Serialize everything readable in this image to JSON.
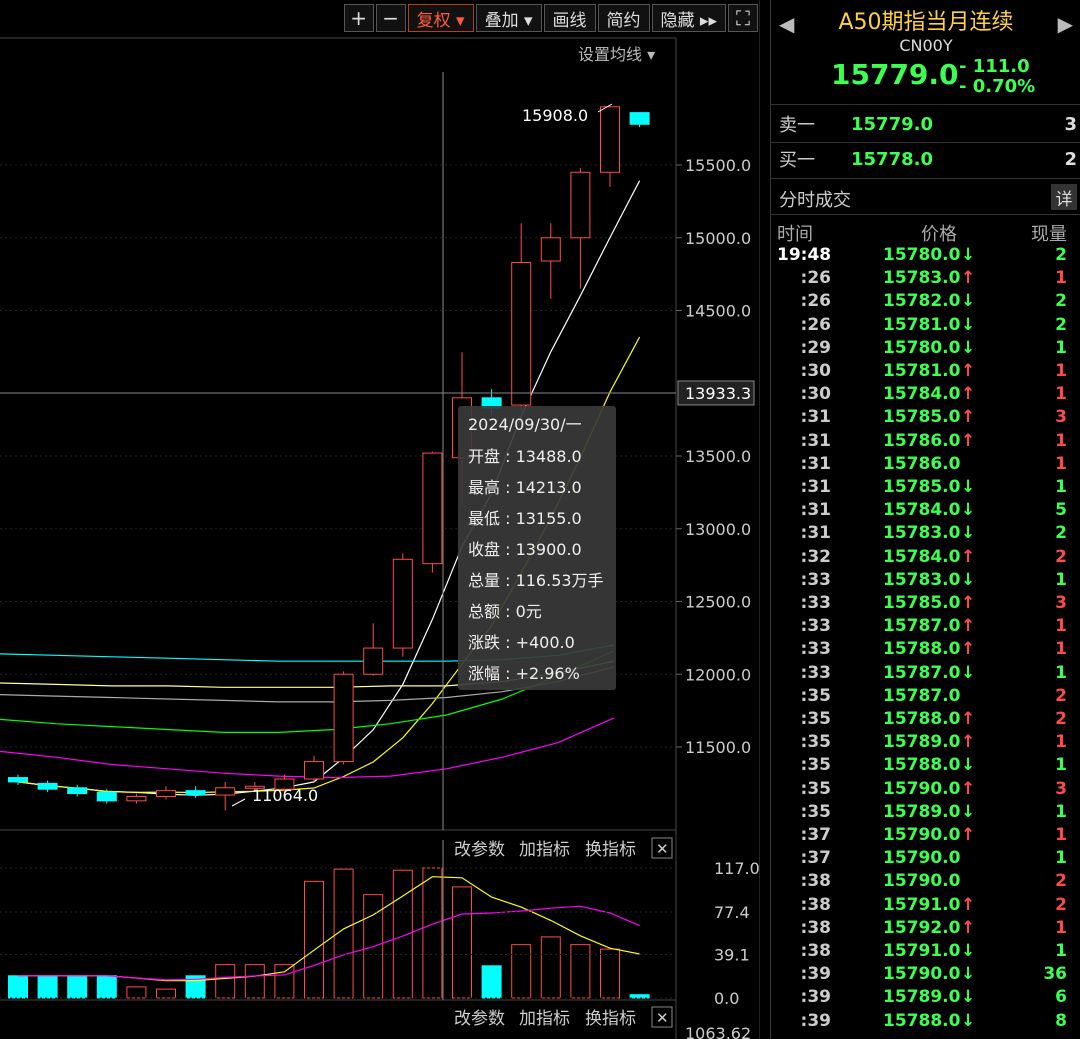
{
  "toolbar": {
    "plus": "+",
    "minus": "−",
    "fuquan": "复权 ▾",
    "diejia": "叠加 ▾",
    "huaxian": "画线",
    "jianyue": "简约",
    "yincang": "隐藏 ▸▸",
    "fullscreen": "⛶"
  },
  "chart": {
    "set_ma": "设置均线 ▾",
    "price_ticks": [
      "15500.0",
      "15000.0",
      "14500.0",
      "13500.0",
      "13000.0",
      "12500.0",
      "12000.0",
      "11500.0"
    ],
    "crosshair_price": "13933.3",
    "high_label": "15908.0",
    "low_label": "11064.0",
    "colors": {
      "up": "#ff4a4a",
      "down": "#00ffff",
      "ma5": "#ffffff",
      "ma10": "#ffff00",
      "ma20": "#ff00ff",
      "ma30": "#00ff00",
      "ma60": "#aaaaaa",
      "ma120": "#ffff99",
      "ma250": "#00ffff"
    }
  },
  "chart_data": {
    "type": "candlestick",
    "candles": [
      {
        "o": 11290,
        "c": 11260,
        "h": 11310,
        "l": 11240
      },
      {
        "o": 11250,
        "c": 11210,
        "h": 11270,
        "l": 11190
      },
      {
        "o": 11220,
        "c": 11180,
        "h": 11240,
        "l": 11160
      },
      {
        "o": 11190,
        "c": 11130,
        "h": 11210,
        "l": 11110
      },
      {
        "o": 11130,
        "c": 11160,
        "h": 11180,
        "l": 11110
      },
      {
        "o": 11160,
        "c": 11200,
        "h": 11230,
        "l": 11140
      },
      {
        "o": 11200,
        "c": 11170,
        "h": 11230,
        "l": 11150
      },
      {
        "o": 11170,
        "c": 11220,
        "h": 11260,
        "l": 11064
      },
      {
        "o": 11220,
        "c": 11230,
        "h": 11260,
        "l": 11200
      },
      {
        "o": 11210,
        "c": 11280,
        "h": 11310,
        "l": 11180
      },
      {
        "o": 11280,
        "c": 11400,
        "h": 11440,
        "l": 11260
      },
      {
        "o": 11400,
        "c": 12000,
        "h": 12020,
        "l": 11380
      },
      {
        "o": 12000,
        "c": 12180,
        "h": 12350,
        "l": 11990
      },
      {
        "o": 12180,
        "c": 12790,
        "h": 12830,
        "l": 12120
      },
      {
        "o": 12760,
        "c": 13520,
        "h": 13530,
        "l": 12700
      },
      {
        "o": 13488,
        "c": 13900,
        "h": 14213,
        "l": 13155
      },
      {
        "o": 13900,
        "c": 13830,
        "h": 13960,
        "l": 13780
      },
      {
        "o": 13850,
        "c": 14830,
        "h": 15100,
        "l": 13800
      },
      {
        "o": 14840,
        "c": 15000,
        "h": 15100,
        "l": 14580
      },
      {
        "o": 15000,
        "c": 15450,
        "h": 15480,
        "l": 14650
      },
      {
        "o": 15450,
        "c": 15900,
        "h": 15908,
        "l": 15350
      },
      {
        "o": 15860,
        "c": 15780,
        "h": 15860,
        "l": 15760
      }
    ],
    "volume_ticks": [
      "117.0",
      "77.4",
      "39.1",
      "0.0"
    ],
    "volumes": [
      20,
      20,
      20,
      20,
      10,
      8,
      20,
      30,
      30,
      30,
      105,
      116,
      93,
      115,
      117,
      100,
      29,
      48,
      55,
      48,
      44,
      3
    ],
    "y_range": [
      11000,
      16000
    ],
    "vol_range": [
      0,
      117
    ]
  },
  "tooltip": {
    "date": "2024/09/30/一",
    "lines": [
      "开盘 : 13488.0",
      "最高 : 14213.0",
      "最低 : 13155.0",
      "收盘 : 13900.0",
      "总量 : 116.53万手",
      "总额 : 0元",
      "涨跌 : +400.0",
      "涨幅 : +2.96%"
    ]
  },
  "indicator_bar": {
    "gaicanshu": "改参数",
    "jiazhibiao": "加指标",
    "huanzhibiao": "换指标",
    "close": "✕"
  },
  "bottom_tick": "1063.62",
  "sidebar": {
    "title": "A50期指当月连续",
    "code": "CN00Y",
    "price": "15779.0",
    "change": "- 111.0",
    "change_pct": "- 0.70%",
    "sell_label": "卖一",
    "sell_price": "15779.0",
    "sell_vol": "3",
    "buy_label": "买一",
    "buy_price": "15778.0",
    "buy_vol": "2",
    "ticks_title": "分时成交",
    "detail": "详",
    "col_time": "时间",
    "col_price": "价格",
    "col_vol": "现量",
    "ticks": [
      {
        "t": "19:48",
        "p": "15780.0",
        "d": "down",
        "v": "2"
      },
      {
        "t": ":26",
        "p": "15783.0",
        "d": "up",
        "v": "1"
      },
      {
        "t": ":26",
        "p": "15782.0",
        "d": "down",
        "v": "2"
      },
      {
        "t": ":26",
        "p": "15781.0",
        "d": "down",
        "v": "2"
      },
      {
        "t": ":29",
        "p": "15780.0",
        "d": "down",
        "v": "1"
      },
      {
        "t": ":30",
        "p": "15781.0",
        "d": "up",
        "v": "1"
      },
      {
        "t": ":30",
        "p": "15784.0",
        "d": "up",
        "v": "1"
      },
      {
        "t": ":31",
        "p": "15785.0",
        "d": "up",
        "v": "3"
      },
      {
        "t": ":31",
        "p": "15786.0",
        "d": "up",
        "v": "1"
      },
      {
        "t": ":31",
        "p": "15786.0",
        "d": "",
        "v": "1"
      },
      {
        "t": ":31",
        "p": "15785.0",
        "d": "down",
        "v": "1"
      },
      {
        "t": ":31",
        "p": "15784.0",
        "d": "down",
        "v": "5"
      },
      {
        "t": ":31",
        "p": "15783.0",
        "d": "down",
        "v": "2"
      },
      {
        "t": ":32",
        "p": "15784.0",
        "d": "up",
        "v": "2"
      },
      {
        "t": ":33",
        "p": "15783.0",
        "d": "down",
        "v": "1"
      },
      {
        "t": ":33",
        "p": "15785.0",
        "d": "up",
        "v": "3"
      },
      {
        "t": ":33",
        "p": "15787.0",
        "d": "up",
        "v": "1"
      },
      {
        "t": ":33",
        "p": "15788.0",
        "d": "up",
        "v": "1"
      },
      {
        "t": ":33",
        "p": "15787.0",
        "d": "down",
        "v": "1"
      },
      {
        "t": ":35",
        "p": "15787.0",
        "d": "",
        "v": "2"
      },
      {
        "t": ":35",
        "p": "15788.0",
        "d": "up",
        "v": "2"
      },
      {
        "t": ":35",
        "p": "15789.0",
        "d": "up",
        "v": "1"
      },
      {
        "t": ":35",
        "p": "15788.0",
        "d": "down",
        "v": "1"
      },
      {
        "t": ":35",
        "p": "15790.0",
        "d": "up",
        "v": "3"
      },
      {
        "t": ":35",
        "p": "15789.0",
        "d": "down",
        "v": "1"
      },
      {
        "t": ":37",
        "p": "15790.0",
        "d": "up",
        "v": "1"
      },
      {
        "t": ":37",
        "p": "15790.0",
        "d": "",
        "v": "1"
      },
      {
        "t": ":38",
        "p": "15790.0",
        "d": "",
        "v": "2"
      },
      {
        "t": ":38",
        "p": "15791.0",
        "d": "up",
        "v": "2"
      },
      {
        "t": ":38",
        "p": "15792.0",
        "d": "up",
        "v": "1"
      },
      {
        "t": ":38",
        "p": "15791.0",
        "d": "down",
        "v": "1"
      },
      {
        "t": ":39",
        "p": "15790.0",
        "d": "down",
        "v": "36"
      },
      {
        "t": ":39",
        "p": "15789.0",
        "d": "down",
        "v": "6"
      },
      {
        "t": ":39",
        "p": "15788.0",
        "d": "down",
        "v": "8"
      }
    ]
  }
}
